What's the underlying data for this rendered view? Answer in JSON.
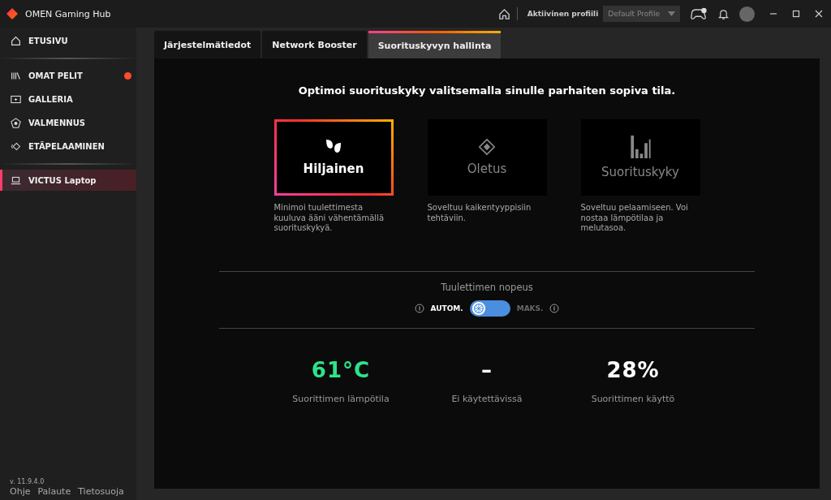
{
  "window": {
    "title": "OMEN Gaming Hub"
  },
  "header": {
    "profile_label": "Aktiivinen profiili",
    "profile_value": "Default Profile"
  },
  "sidebar": {
    "sections": [
      {
        "items": [
          {
            "label": "ETUSIVU",
            "kind": "home",
            "selected": false,
            "badge": false
          }
        ]
      },
      {
        "items": [
          {
            "label": "OMAT PELIT",
            "kind": "library",
            "selected": false,
            "badge": true
          },
          {
            "label": "GALLERIA",
            "kind": "gallery",
            "selected": false,
            "badge": false
          },
          {
            "label": "VALMENNUS",
            "kind": "coach",
            "selected": false,
            "badge": false
          },
          {
            "label": "ETÄPELAAMINEN",
            "kind": "remote",
            "selected": false,
            "badge": false
          }
        ]
      },
      {
        "items": [
          {
            "label": "VICTUS Laptop",
            "kind": "laptop",
            "selected": true,
            "badge": false
          }
        ]
      }
    ],
    "version": "v. 11.9.4.0",
    "links": [
      "Ohje",
      "Palaute",
      "Tietosuoja"
    ]
  },
  "tabs": [
    {
      "label": "Järjestelmätiedot",
      "selected": false
    },
    {
      "label": "Network Booster",
      "selected": false
    },
    {
      "label": "Suorituskyvyn hallinta",
      "selected": true
    }
  ],
  "heading": "Optimoi suorituskyky valitsemalla sinulle parhaiten sopiva tila.",
  "modes": [
    {
      "kind": "leaves",
      "name": "Hiljainen",
      "description": "Minimoi tuulettimesta kuuluva ääni vähentämällä suorituskykyä.",
      "selected": true
    },
    {
      "kind": "diamond",
      "name": "Oletus",
      "description": "Soveltuu kaikentyyppisiin tehtäviin.",
      "selected": false
    },
    {
      "kind": "bars",
      "name": "Suorituskyky",
      "description": "Soveltuu pelaamiseen. Voi nostaa lämpötilaa ja melutasoa.",
      "selected": false
    }
  ],
  "fan_speed": {
    "title": "Tuulettimen nopeus",
    "options": [
      {
        "label": "AUTOM.",
        "selected": true
      },
      {
        "label": "MAKS.",
        "selected": false
      }
    ]
  },
  "stats": [
    {
      "value": "61°C",
      "label": "Suorittimen lämpötila",
      "color": "#2de38a"
    },
    {
      "value": "–",
      "label": "Ei käytettävissä",
      "color": "#ffffff"
    },
    {
      "value": "28%",
      "label": "Suorittimen käyttö",
      "color": "#ffffff"
    }
  ]
}
